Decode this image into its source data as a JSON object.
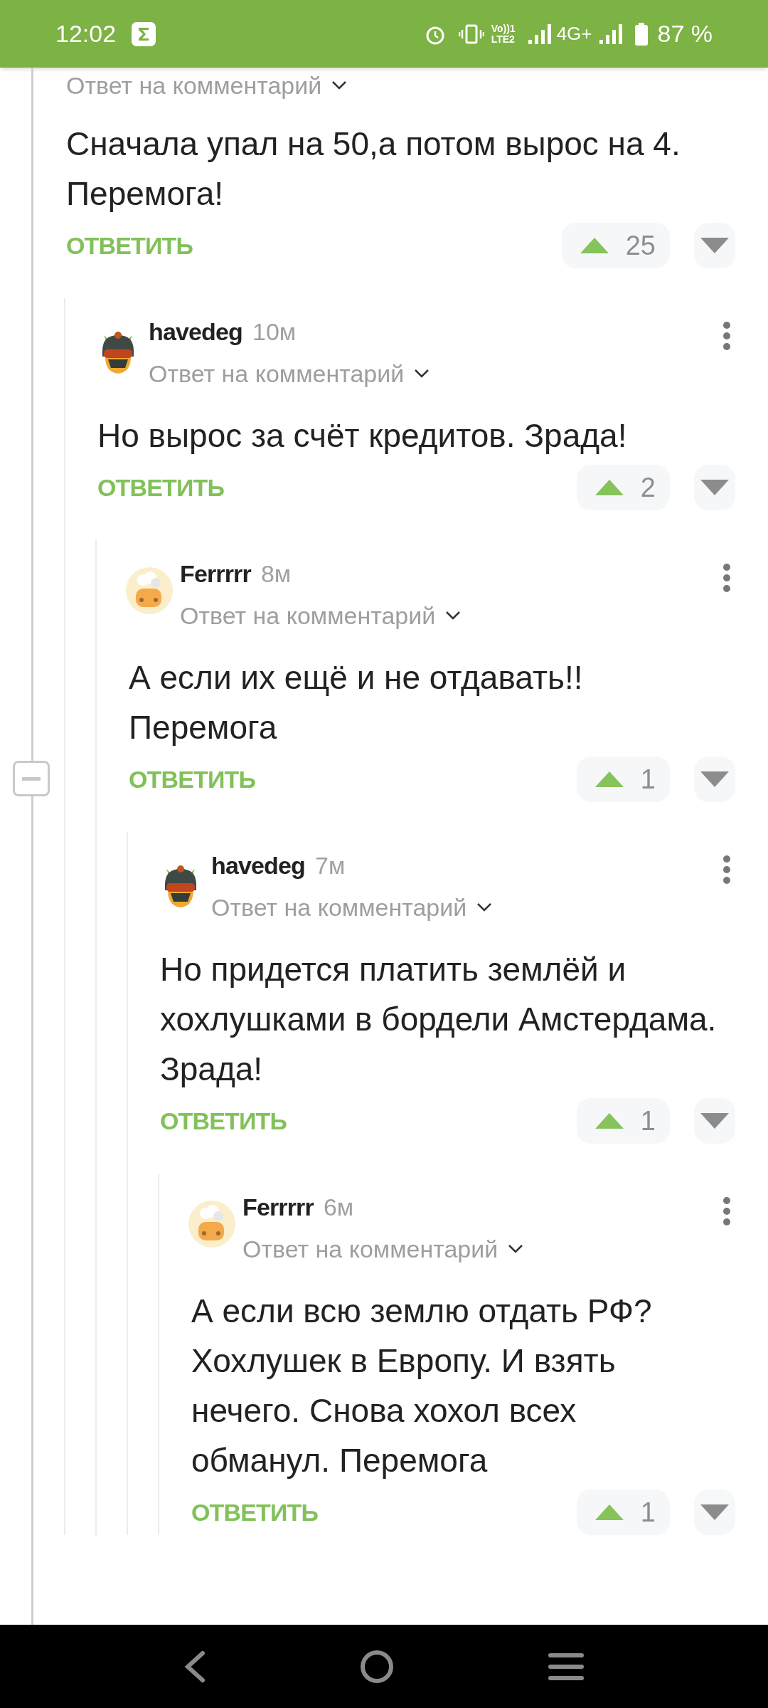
{
  "status_bar": {
    "time": "12:02",
    "volte": [
      "Vo))1",
      "LTE2"
    ],
    "network": "4G+",
    "battery": "87 %"
  },
  "thread": {
    "expanded": true
  },
  "comments": [
    {
      "reply_to": "Ответ на **комментарий**",
      "text": "Сначала упал на 50,а потом вырос на 4. Перемога!",
      "reply_label": "ОТВЕТИТЬ",
      "votes": "25",
      "children": [
        {
          "author": "havedeg",
          "time": "10м",
          "avatar": {
            "kind": "helmet"
          },
          "reply_to": "Ответ на **комментарий**",
          "text": "Но вырос за счёт кредитов. Зрада!",
          "reply_label": "ОТВЕТИТЬ",
          "votes": "2",
          "children": [
            {
              "author": "Ferrrrr",
              "time": "8м",
              "avatar": {
                "kind": "chef"
              },
              "reply_to": "Ответ на **комментарий**",
              "text": "А если их ещё и не отдавать!! Перемога",
              "reply_label": "ОТВЕТИТЬ",
              "votes": "1",
              "children": [
                {
                  "author": "havedeg",
                  "time": "7м",
                  "avatar": {
                    "kind": "helmet"
                  },
                  "reply_to": "Ответ на **комментарий**",
                  "text": "Но придется платить землёй и хохлушками в бордели Амстердама. Зрада!",
                  "reply_label": "ОТВЕТИТЬ",
                  "votes": "1",
                  "children": [
                    {
                      "author": "Ferrrrr",
                      "time": "6м",
                      "avatar": {
                        "kind": "chef"
                      },
                      "reply_to": "Ответ на **комментарий**",
                      "text": "А если всю землю отдать РФ? Хохлушек в Европу. И взять нечего. Снова хохол всех обманул. Перемога",
                      "reply_label": "ОТВЕТИТЬ",
                      "votes": "1"
                    }
                  ]
                }
              ]
            }
          ]
        }
      ]
    }
  ]
}
